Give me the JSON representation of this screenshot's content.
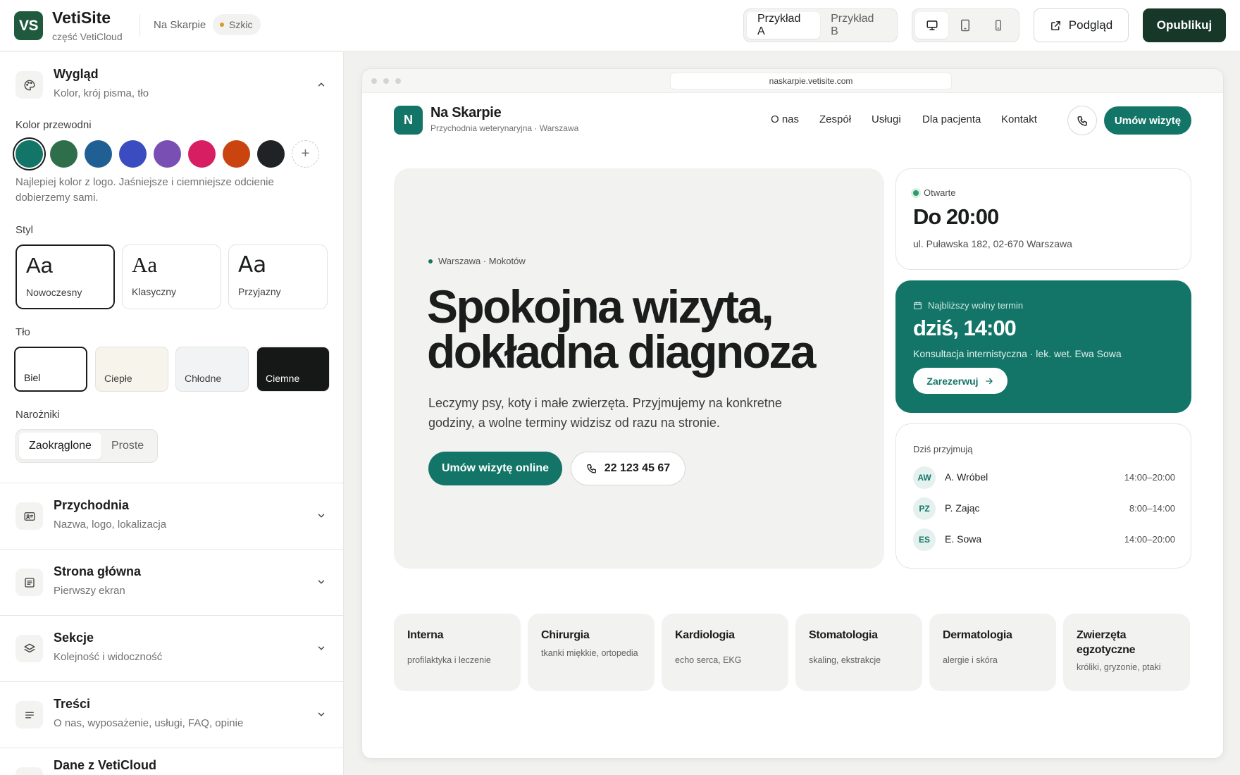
{
  "app": {
    "logo_text": "VS",
    "name": "VetiSite",
    "subtitle": "część VetiCloud",
    "site_name": "Na Skarpie",
    "status": "Szkic",
    "examples": [
      "Przykład A",
      "Przykład B"
    ],
    "preview_label": "Podgląd",
    "publish_label": "Opublikuj"
  },
  "sidebar": {
    "appearance": {
      "title": "Wygląd",
      "subtitle": "Kolor, krój pisma, tło",
      "accent_label": "Kolor przewodni",
      "swatches": [
        "#137567",
        "#2f6e4b",
        "#1f5f94",
        "#3b4cc0",
        "#7a4fb3",
        "#d81e62",
        "#c9440f",
        "#1f2326"
      ],
      "selected_swatch": 0,
      "accent_hint": "Najlepiej kolor z logo. Jaśniejsze i ciemniejsze odcienie dobierzemy sami.",
      "style_label": "Styl",
      "styles": [
        {
          "sample": "Aa",
          "name": "Nowoczesny"
        },
        {
          "sample": "Aa",
          "name": "Klasyczny"
        },
        {
          "sample": "Aa",
          "name": "Przyjazny"
        }
      ],
      "bg_label": "Tło",
      "backgrounds": [
        {
          "name": "Biel",
          "color": "#ffffff"
        },
        {
          "name": "Ciepłe",
          "color": "#f7f4ec"
        },
        {
          "name": "Chłodne",
          "color": "#f1f3f4"
        },
        {
          "name": "Ciemne",
          "color": "#151817"
        }
      ],
      "corners_label": "Narożniki",
      "corners": [
        "Zaokrąglone",
        "Proste"
      ]
    },
    "sections": [
      {
        "title": "Przychodnia",
        "subtitle": "Nazwa, logo, lokalizacja"
      },
      {
        "title": "Strona główna",
        "subtitle": "Pierwszy ekran"
      },
      {
        "title": "Sekcje",
        "subtitle": "Kolejność i widoczność"
      },
      {
        "title": "Treści",
        "subtitle": "O nas, wyposażenie, usługi, FAQ, opinie"
      },
      {
        "title": "Dane z VetiCloud",
        "subtitle": ""
      }
    ]
  },
  "preview": {
    "url": "naskarpie.vetisite.com",
    "logo_letter": "N",
    "title": "Na Skarpie",
    "tagline": "Przychodnia weterynaryjna · Warszawa",
    "nav": [
      "O nas",
      "Zespół",
      "Usługi",
      "Dla pacjenta",
      "Kontakt"
    ],
    "book_label": "Umów wizytę",
    "hero": {
      "location": "Warszawa · Mokotów",
      "heading_line1": "Spokojna wizyta,",
      "heading_line2": "dokładna diagnoza",
      "text": "Leczymy psy, koty i małe zwierzęta. Przyjmujemy na konkretne godziny, a wolne terminy widzisz od razu na stronie.",
      "cta": "Umów wizytę online",
      "phone": "22 123 45 67"
    },
    "open": {
      "status": "Otwarte",
      "time": "Do 20:00",
      "address": "ul. Puławska 182, 02-670 Warszawa"
    },
    "slot": {
      "label": "Najbliższy wolny termin",
      "time": "dziś, 14:00",
      "desc": "Konsultacja internistyczna · lek. wet. Ewa Sowa",
      "button": "Zarezerwuj"
    },
    "staff": {
      "heading": "Dziś przyjmują",
      "rows": [
        {
          "initials": "AW",
          "name": "A. Wróbel",
          "hours": "14:00–20:00"
        },
        {
          "initials": "PZ",
          "name": "P. Zając",
          "hours": "8:00–14:00"
        },
        {
          "initials": "ES",
          "name": "E. Sowa",
          "hours": "14:00–20:00"
        }
      ]
    },
    "services": [
      {
        "title": "Interna",
        "desc": "profilaktyka i leczenie"
      },
      {
        "title": "Chirurgia",
        "desc": "tkanki miękkie, ortopedia"
      },
      {
        "title": "Kardiologia",
        "desc": "echo serca, EKG"
      },
      {
        "title": "Stomatologia",
        "desc": "skaling, ekstrakcje"
      },
      {
        "title": "Dermatologia",
        "desc": "alergie i skóra"
      },
      {
        "title": "Zwierzęta egzotyczne",
        "desc": "króliki, gryzonie, ptaki"
      }
    ]
  }
}
